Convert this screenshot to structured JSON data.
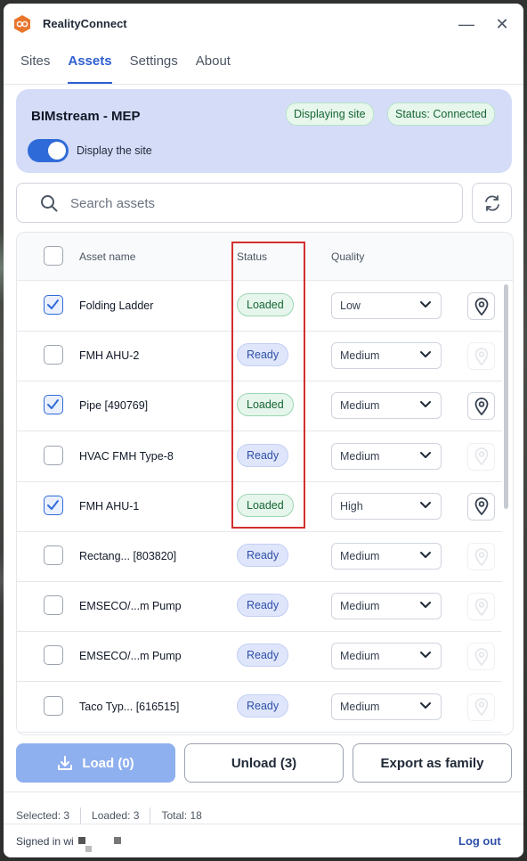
{
  "app": {
    "title": "RealityConnect"
  },
  "window_controls": {
    "minimize": "—",
    "close": "✕"
  },
  "tabs": [
    {
      "label": "Sites",
      "active": false
    },
    {
      "label": "Assets",
      "active": true
    },
    {
      "label": "Settings",
      "active": false
    },
    {
      "label": "About",
      "active": false
    }
  ],
  "site": {
    "name": "BIMstream - MEP",
    "display_pill": "Displaying site",
    "status_pill": "Status: Connected",
    "toggle_label": "Display the site",
    "toggle_on": true
  },
  "search": {
    "placeholder": "Search assets",
    "value": ""
  },
  "table": {
    "headers": {
      "name": "Asset name",
      "status": "Status",
      "quality": "Quality"
    },
    "rows": [
      {
        "name": "Folding Ladder",
        "status": "Loaded",
        "quality": "Low",
        "checked": true
      },
      {
        "name": "FMH AHU-2",
        "status": "Ready",
        "quality": "Medium",
        "checked": false
      },
      {
        "name": "Pipe [490769]",
        "status": "Loaded",
        "quality": "Medium",
        "checked": true
      },
      {
        "name": "HVAC FMH Type-8",
        "status": "Ready",
        "quality": "Medium",
        "checked": false
      },
      {
        "name": "FMH AHU-1",
        "status": "Loaded",
        "quality": "High",
        "checked": true
      },
      {
        "name": "Rectang... [803820]",
        "status": "Ready",
        "quality": "Medium",
        "checked": false
      },
      {
        "name": "EMSECO/...m Pump",
        "status": "Ready",
        "quality": "Medium",
        "checked": false
      },
      {
        "name": "EMSECO/...m Pump",
        "status": "Ready",
        "quality": "Medium",
        "checked": false
      },
      {
        "name": "Taco Typ... [616515]",
        "status": "Ready",
        "quality": "Medium",
        "checked": false
      }
    ]
  },
  "actions": {
    "load": "Load (0)",
    "unload": "Unload (3)",
    "export": "Export as family"
  },
  "footer": {
    "selected": "Selected: 3",
    "loaded": "Loaded: 3",
    "total": "Total: 18",
    "signed_in": "Signed in wi",
    "logout": "Log out"
  },
  "colors": {
    "accent": "#2f6bd8",
    "loaded_badge": "#e6f6ec",
    "ready_badge": "#dfe6fb",
    "highlight_box": "#d32f2f"
  }
}
